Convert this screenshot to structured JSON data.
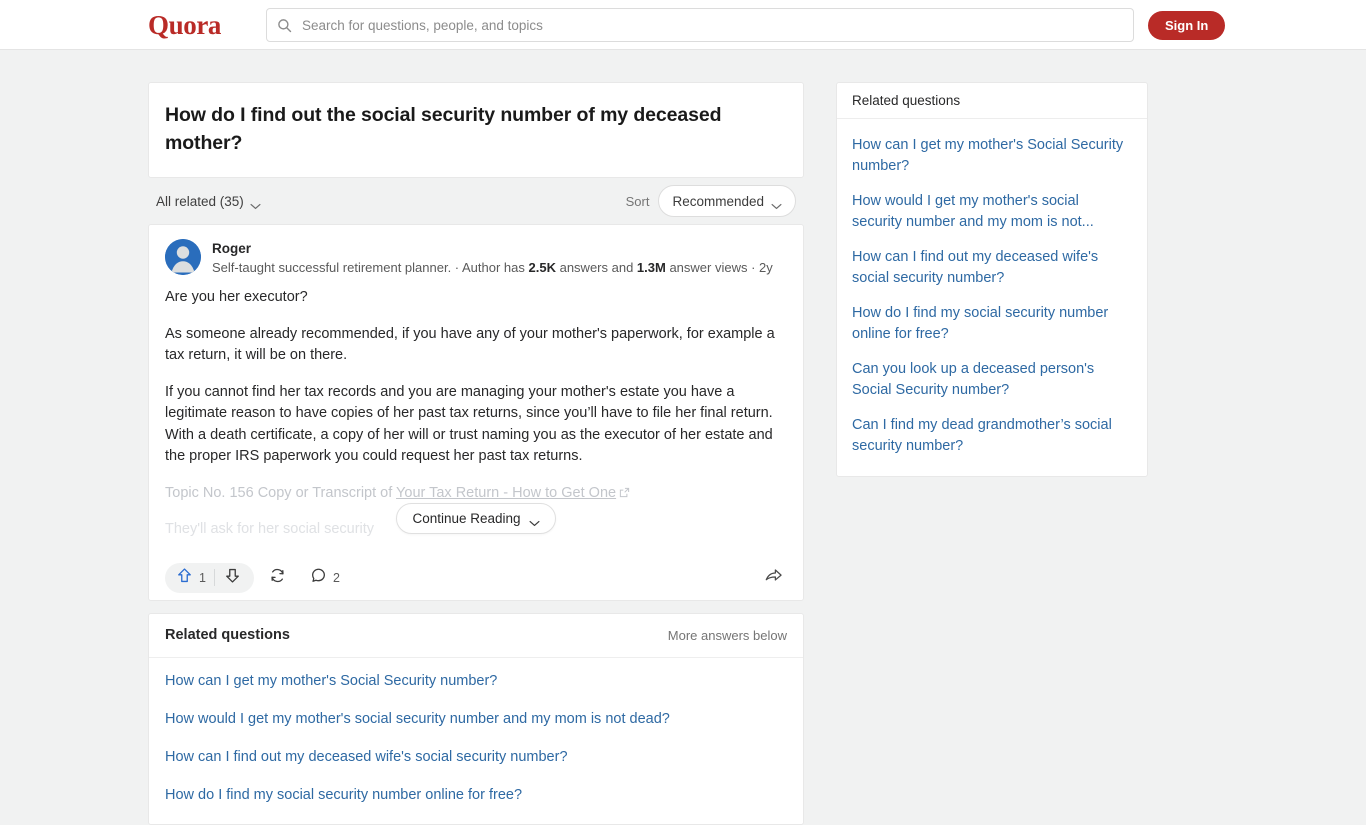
{
  "header": {
    "logo_text": "Quora",
    "search_placeholder": "Search for questions, people, and topics",
    "search_value": "",
    "signin_label": "Sign In"
  },
  "question": {
    "title": "How do I find out the social security number of my deceased mother?"
  },
  "filter_bar": {
    "all_related_label": "All related (35)",
    "sort_label": "Sort",
    "sort_value": "Recommended"
  },
  "answer": {
    "author_name": "Roger",
    "credential_prefix": "Self-taught successful retirement planner. · Author has ",
    "answers_count": "2.5K",
    "credential_mid": " answers and ",
    "views_count": "1.3M",
    "credential_suffix": " answer views · 2y",
    "paragraphs": [
      "Are you her executor?",
      "As someone already recommended, if you have any of your mother's paperwork, for example a tax return, it will be on there.",
      "If you cannot find her tax records and you are managing your mother's estate you have a legitimate reason to have copies of her past tax returns, since you’ll have to file her final return. With a death certificate, a copy of her will or trust naming you as the executor of her estate and the proper IRS paperwork you could request her past tax returns."
    ],
    "topic_line_prefix": "Topic No. 156 Copy or Transcript of ",
    "topic_line_link": "Your Tax Return - How to Get One",
    "truncated_line": "They'll ask for her social security",
    "continue_label": "Continue Reading",
    "upvote_count": "1",
    "comment_count": "2"
  },
  "related_main": {
    "heading": "Related questions",
    "more_answers_label": "More answers below",
    "items": [
      "How can I get my mother's Social Security number?",
      "How would I get my mother's social security number and my mom is not dead?",
      "How can I find out my deceased wife's social security number?",
      "How do I find my social security number online for free?"
    ]
  },
  "sidebar": {
    "heading": "Related questions",
    "items": [
      "How can I get my mother's Social Security number?",
      "How would I get my mother's social security number and my mom is not...",
      "How can I find out my deceased wife's social security number?",
      "How do I find my social security number online for free?",
      "Can you look up a deceased person's Social Security number?",
      "Can I find my dead grandmother’s social security number?"
    ]
  },
  "colors": {
    "brand_red": "#b92b27",
    "link_blue": "#2e69a3",
    "upvote_blue": "#2b6dd1",
    "page_bg": "#f1f2f2"
  }
}
